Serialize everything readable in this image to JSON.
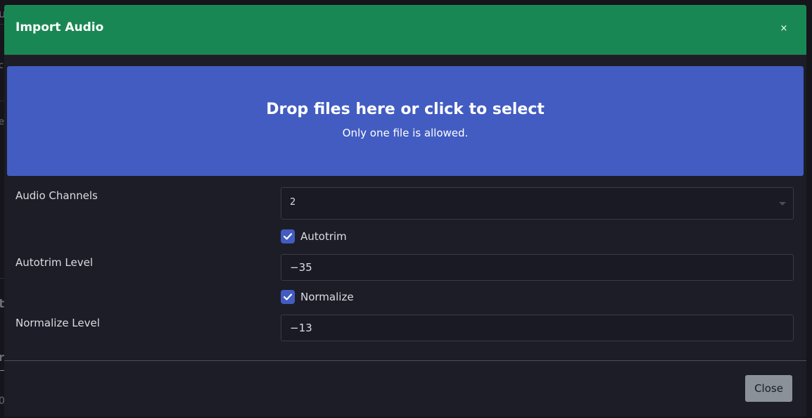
{
  "modal": {
    "title": "Import Audio",
    "close_symbol": "×"
  },
  "dropzone": {
    "title": "Drop files here or click to select",
    "subtitle": "Only one file is allowed."
  },
  "form": {
    "audio_channels": {
      "label": "Audio Channels",
      "value": "2"
    },
    "autotrim": {
      "label": "Autotrim",
      "checked": true
    },
    "autotrim_level": {
      "label": "Autotrim Level",
      "value": "−35"
    },
    "normalize": {
      "label": "Normalize",
      "checked": true
    },
    "normalize_level": {
      "label": "Normalize Level",
      "value": "−13"
    }
  },
  "footer": {
    "close_label": "Close"
  },
  "colors": {
    "header": "#198754",
    "dropzone": "#425cc1",
    "checkbox": "#425cc1",
    "modal_body": "#1d1d27",
    "close_button": "#8a9199"
  },
  "background_fragments": [
    "u",
    "c",
    "e",
    "t",
    "r",
    "0"
  ]
}
